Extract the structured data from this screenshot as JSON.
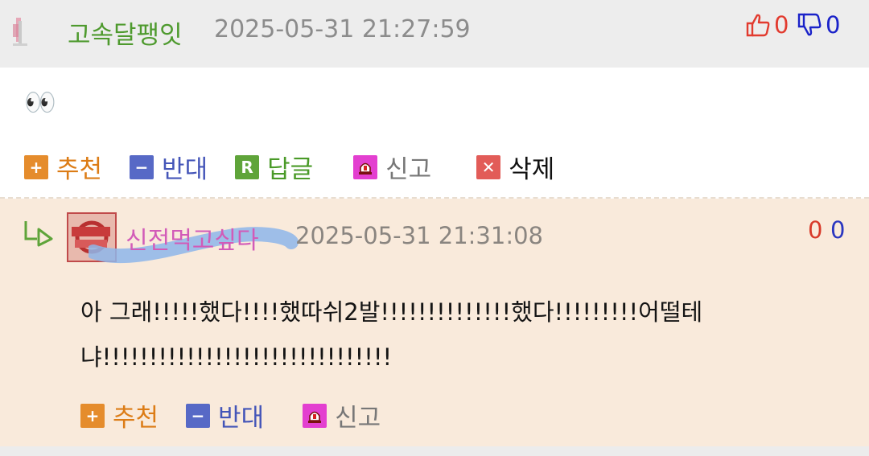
{
  "comment": {
    "author": "고속달팽잇",
    "timestamp": "2025-05-31 21:27:59",
    "likes": "0",
    "dislikes": "0",
    "content": "👀",
    "actions": {
      "recommend": "추천",
      "oppose": "반대",
      "reply": "답글",
      "report": "신고",
      "delete": "삭제"
    }
  },
  "reply": {
    "author": "신전먹고싶다",
    "timestamp": "2025-05-31 21:31:08",
    "likes": "0",
    "dislikes": "0",
    "content_line1": "아 그래!!!!!했다!!!!했따쉬2발!!!!!!!!!!!!!!했다!!!!!!!!!어떨테",
    "content_line2": "냐!!!!!!!!!!!!!!!!!!!!!!!!!!!!!!!",
    "actions": {
      "recommend": "추천",
      "oppose": "반대",
      "report": "신고"
    }
  },
  "colors": {
    "author_green": "#4e9a2e",
    "reply_author_pink": "#d25bb8",
    "like_red": "#e23b2f",
    "dislike_blue": "#1a22c9",
    "reply_bg": "#f9eadb"
  },
  "icons": [
    "thumbs-up-icon",
    "thumbs-down-icon",
    "plus-icon",
    "minus-icon",
    "reply-r-icon",
    "siren-icon",
    "close-icon",
    "reply-arrow-icon"
  ]
}
